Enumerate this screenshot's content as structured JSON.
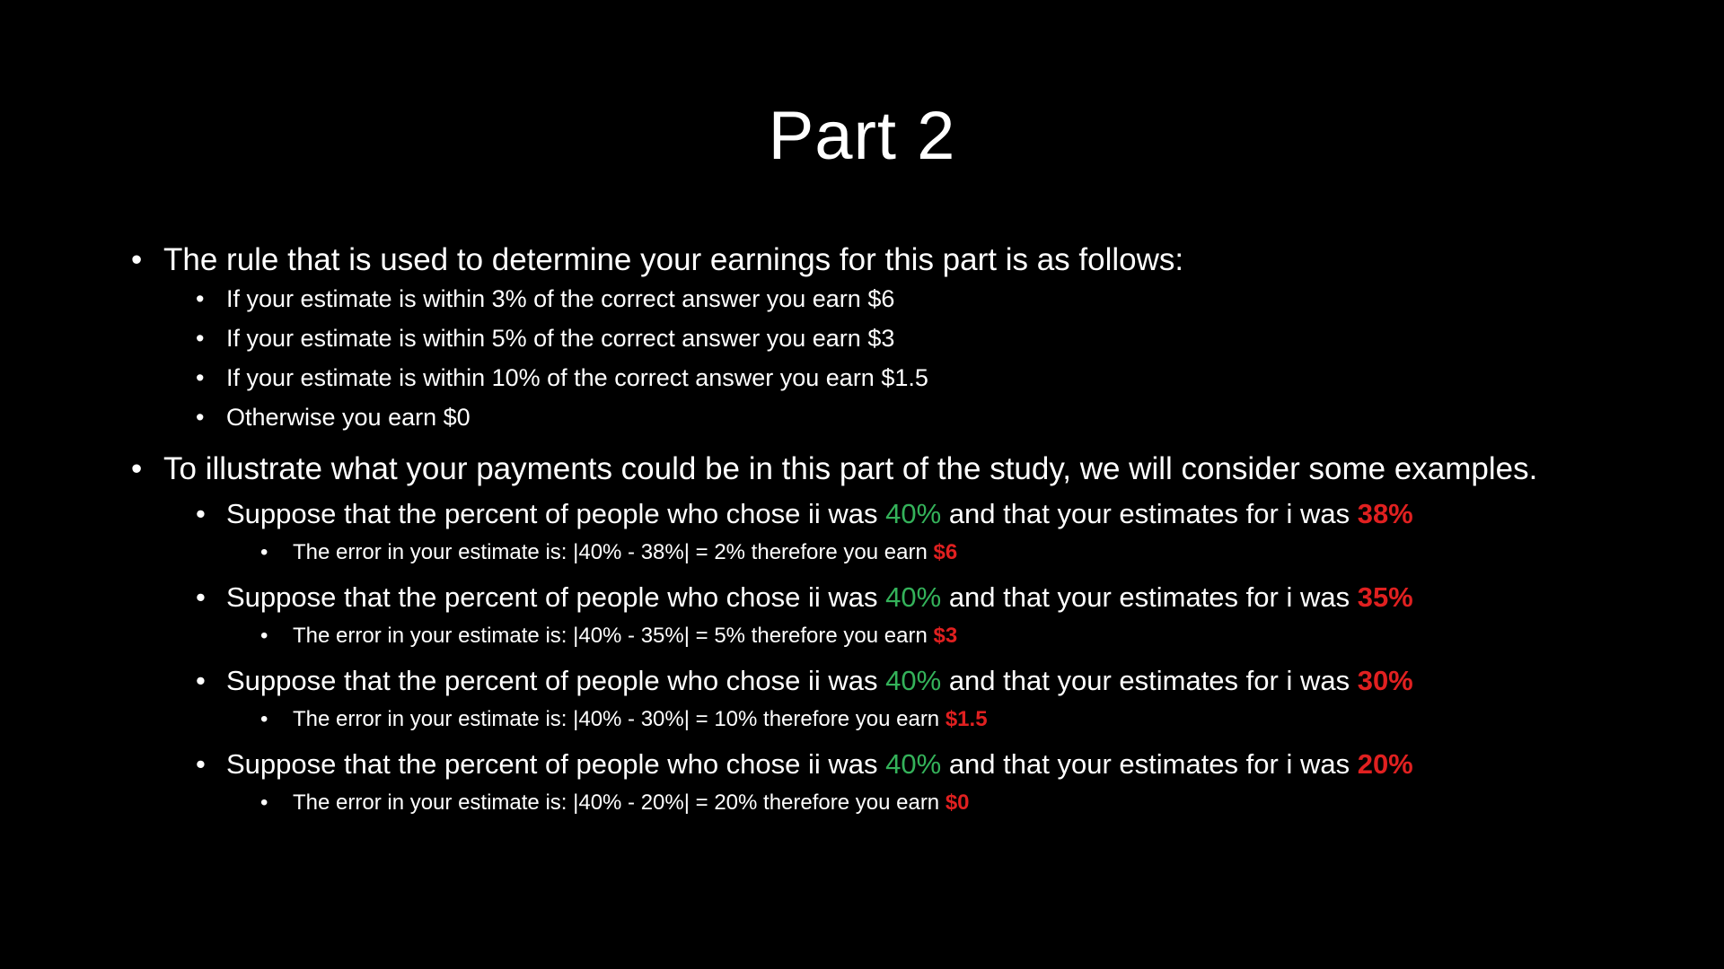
{
  "slide": {
    "title": "Part 2",
    "rule_intro": "The rule that is used to determine your earnings for this part is as follows:",
    "rules": [
      "If your estimate is within 3% of the correct answer you earn $6",
      "If your estimate is within 5% of the correct answer you earn $3",
      "If your estimate is within 10% of the correct answer you earn $1.5",
      "Otherwise you earn $0"
    ],
    "examples_intro": "To illustrate what your payments could be in this part of the study, we will consider some examples.",
    "examples": [
      {
        "lead": "Suppose that the percent of people who chose ii was ",
        "actual": "40%",
        "mid": " and that your estimates for i was ",
        "estimate": "38%",
        "error_text": "The error in your estimate is: |40% - 38%| = 2% therefore you earn ",
        "earn": "$6"
      },
      {
        "lead": "Suppose that the percent of people who chose ii was ",
        "actual": "40%",
        "mid": " and that your estimates for i was ",
        "estimate": "35%",
        "error_text": "The error in your estimate is: |40% - 35%| = 5% therefore you earn ",
        "earn": "$3"
      },
      {
        "lead": "Suppose that the percent of people who chose ii was ",
        "actual": "40%",
        "mid": " and that your estimates for i was ",
        "estimate": "30%",
        "error_text": "The error in your estimate is: |40% - 30%| = 10% therefore you earn ",
        "earn": "$1.5"
      },
      {
        "lead": "Suppose that the percent of people who chose ii was ",
        "actual": "40%",
        "mid": " and that your estimates for i was ",
        "estimate": "20%",
        "error_text": "The error in your estimate is: |40% - 20%| = 20% therefore you earn ",
        "earn": "$0"
      }
    ]
  },
  "colors": {
    "background": "#000000",
    "text": "#ffffff",
    "highlight_green": "#34b25a",
    "highlight_red": "#e02020"
  }
}
